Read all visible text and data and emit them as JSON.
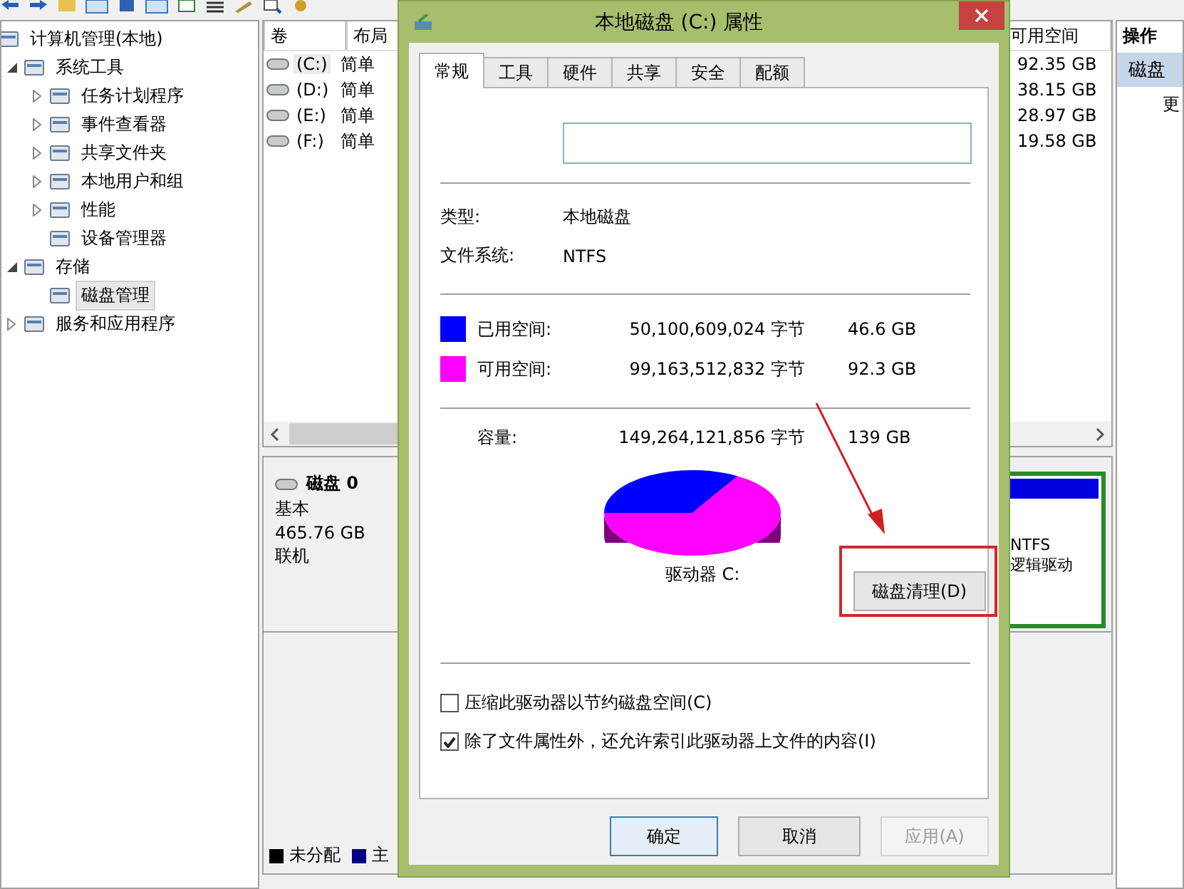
{
  "tree": [
    {
      "label": "计算机管理(本地)",
      "selected": false,
      "children": [
        {
          "label": "系统工具",
          "selected": false,
          "expanded": true,
          "children": [
            {
              "label": "任务计划程序",
              "selected": false,
              "expanded": false
            },
            {
              "label": "事件查看器",
              "selected": false,
              "expanded": false
            },
            {
              "label": "共享文件夹",
              "selected": false,
              "expanded": false
            },
            {
              "label": "本地用户和组",
              "selected": false,
              "expanded": false
            },
            {
              "label": "性能",
              "selected": false,
              "expanded": false
            },
            {
              "label": "设备管理器",
              "selected": false
            }
          ]
        },
        {
          "label": "存储",
          "selected": false,
          "expanded": true,
          "children": [
            {
              "label": "磁盘管理",
              "selected": true
            }
          ]
        },
        {
          "label": "服务和应用程序",
          "selected": false,
          "expanded": false
        }
      ]
    }
  ],
  "volumes": {
    "columns": [
      "卷",
      "布局",
      "可用空间"
    ],
    "rows": [
      {
        "volume": "(C:)",
        "layout": "简单",
        "free": "92.35 GB",
        "selected": true
      },
      {
        "volume": "(D:)",
        "layout": "简单",
        "free": "38.15 GB",
        "selected": false
      },
      {
        "volume": "(E:)",
        "layout": "简单",
        "free": "28.97 GB",
        "selected": false
      },
      {
        "volume": "(F:)",
        "layout": "简单",
        "free": "19.58 GB",
        "selected": false
      }
    ]
  },
  "disk": {
    "name": "磁盘 0",
    "type": "基本",
    "size": "465.76 GB",
    "status": "联机"
  },
  "partition": {
    "filesystem": "NTFS",
    "type": "逻辑驱动"
  },
  "legend": [
    {
      "label": "未分配",
      "color": "#000000"
    },
    {
      "label": "主",
      "color": "#000080"
    }
  ],
  "actions": {
    "title": "操作",
    "section": "磁盘",
    "link": "更"
  },
  "dialog": {
    "title": "本地磁盘 (C:) 属性",
    "tabs": [
      {
        "label": "常规",
        "selected": true
      },
      {
        "label": "工具",
        "selected": false
      },
      {
        "label": "硬件",
        "selected": false
      },
      {
        "label": "共享",
        "selected": false
      },
      {
        "label": "安全",
        "selected": false
      },
      {
        "label": "配额",
        "selected": false
      }
    ],
    "info": [
      {
        "label": "类型:",
        "value": "本地磁盘"
      },
      {
        "label": "文件系统:",
        "value": "NTFS"
      }
    ],
    "space": [
      {
        "label": "已用空间:",
        "bytes": "50,100,609,024 字节",
        "size": "46.6 GB",
        "color": "#0000ff"
      },
      {
        "label": "可用空间:",
        "bytes": "99,163,512,832 字节",
        "size": "92.3 GB",
        "color": "#ff00ff"
      }
    ],
    "capacity": {
      "label": "容量:",
      "bytes": "149,264,121,856 字节",
      "size": "139 GB"
    },
    "drive_label": "驱动器 C:",
    "cleanup_button": "磁盘清理(D)",
    "options": [
      {
        "label": "压缩此驱动器以节约磁盘空间(C)",
        "checked": false
      },
      {
        "label": "除了文件属性外，还允许索引此驱动器上文件的内容(I)",
        "checked": true
      }
    ],
    "buttons": [
      {
        "label": "确定",
        "default": true,
        "disabled": false
      },
      {
        "label": "取消",
        "default": false,
        "disabled": false
      },
      {
        "label": "应用(A)",
        "default": false,
        "disabled": true
      }
    ]
  }
}
